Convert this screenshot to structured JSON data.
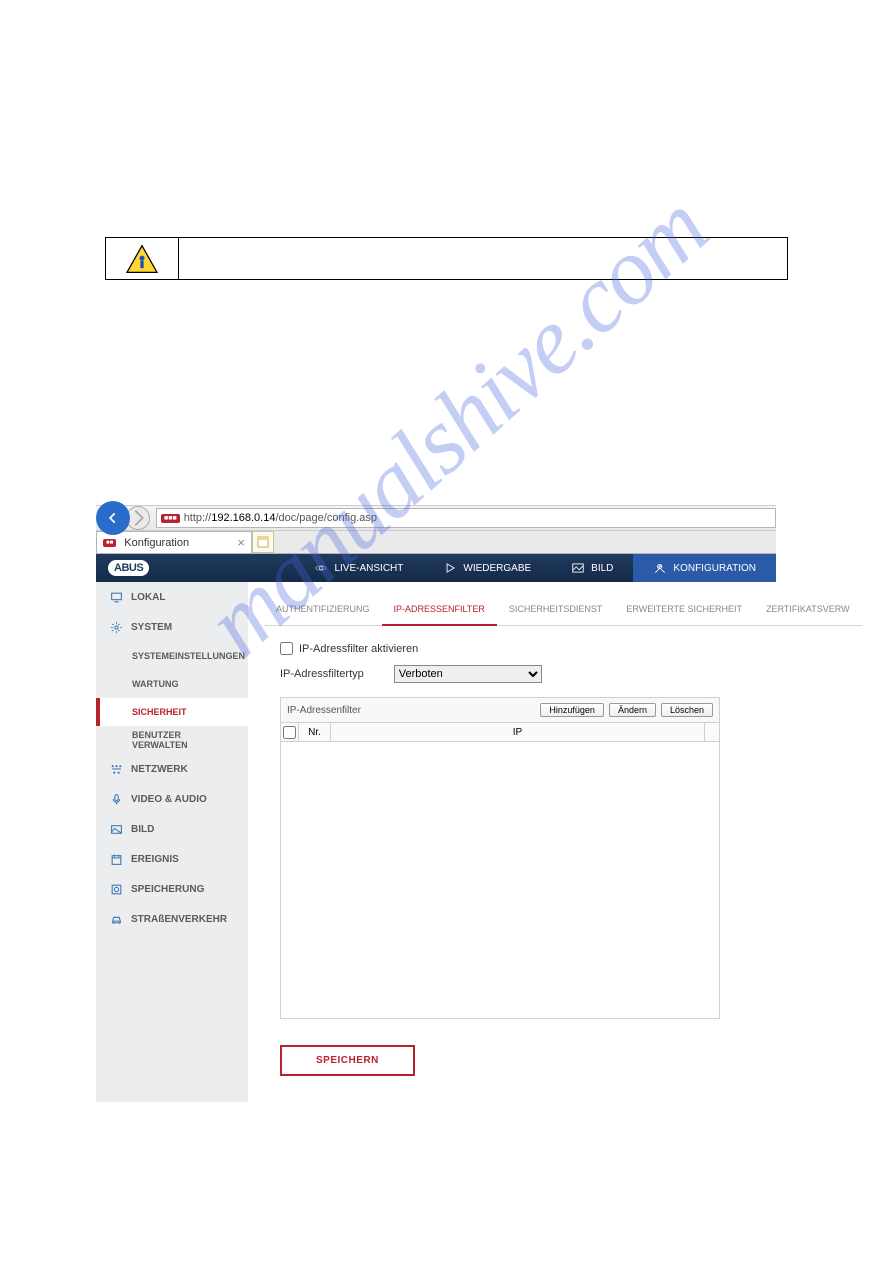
{
  "watermark": "manualshive.com",
  "browser": {
    "url_prefix": "http://",
    "url_host": "192.168.0.14",
    "url_path": "/doc/page/config.asp",
    "tab_title": "Konfiguration"
  },
  "header": {
    "logo": "ABUS",
    "nav": [
      {
        "label": "LIVE-ANSICHT"
      },
      {
        "label": "WIEDERGABE"
      },
      {
        "label": "BILD"
      },
      {
        "label": "KONFIGURATION"
      }
    ]
  },
  "sidebar": {
    "items": [
      {
        "label": "LOKAL"
      },
      {
        "label": "SYSTEM"
      },
      {
        "label": "SYSTEMEINSTELLUNGEN",
        "sub": true
      },
      {
        "label": "WARTUNG",
        "sub": true
      },
      {
        "label": "SICHERHEIT",
        "sub": true,
        "active": true
      },
      {
        "label": "BENUTZER VERWALTEN",
        "sub": true
      },
      {
        "label": "NETZWERK"
      },
      {
        "label": "VIDEO & AUDIO"
      },
      {
        "label": "BILD"
      },
      {
        "label": "EREIGNIS"
      },
      {
        "label": "SPEICHERUNG"
      },
      {
        "label": "STRAßENVERKEHR"
      }
    ]
  },
  "subtabs": [
    {
      "label": "AUTHENTIFIZIERUNG"
    },
    {
      "label": "IP-ADRESSENFILTER",
      "active": true
    },
    {
      "label": "SICHERHEITSDIENST"
    },
    {
      "label": "ERWEITERTE SICHERHEIT"
    },
    {
      "label": "ZERTIFIKATSVERW"
    }
  ],
  "form": {
    "checkbox_label": "IP-Adressfilter aktivieren",
    "select_label": "IP-Adressfiltertyp",
    "select_value": "Verboten",
    "table_title": "IP-Adressenfilter",
    "buttons": {
      "add": "Hinzufügen",
      "edit": "Ändern",
      "delete": "Löschen"
    },
    "columns": {
      "nr": "Nr.",
      "ip": "IP"
    },
    "save": "SPEICHERN"
  }
}
